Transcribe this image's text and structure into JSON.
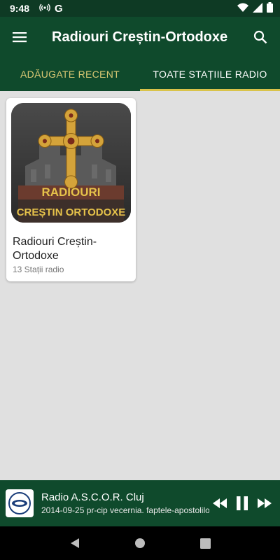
{
  "status_bar": {
    "time": "9:48",
    "icons": [
      "hotspot-icon",
      "g-icon",
      "wifi-icon",
      "signal-icon",
      "battery-icon"
    ],
    "g_letter": "G"
  },
  "app_bar": {
    "title": "Radiouri Creștin-Ortodoxe",
    "menu_icon": "menu-icon",
    "search_icon": "search-icon"
  },
  "tabs": [
    {
      "label": "ADĂUGATE RECENT",
      "active": false
    },
    {
      "label": "TOATE STAȚIILE RADIO",
      "active": true
    }
  ],
  "cards": [
    {
      "name": "Radiouri Creștin-Ortodoxe",
      "count": "13 Stații radio",
      "thumb_text_line1": "RADIOURI",
      "thumb_text_line2": "CREȘTIN ORTODOXE"
    }
  ],
  "player": {
    "station": "Radio A.S.C.O.R. Cluj",
    "track": "2014-09-25 pr-cip vecernia. faptele-apostolilor",
    "state": "playing"
  },
  "colors": {
    "primary": "#0f4a2c",
    "status": "#0e3a24",
    "accent": "#d9c34a",
    "tab_inactive": "#d8c773"
  }
}
